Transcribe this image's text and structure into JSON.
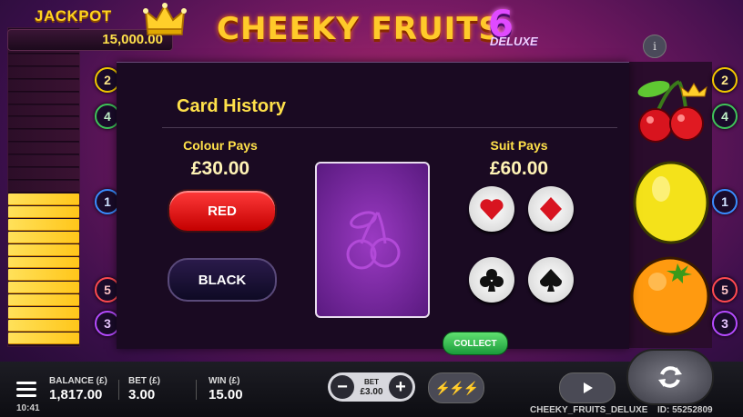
{
  "jackpot": {
    "label": "JACKPOT",
    "value": "15,000.00",
    "lit_rungs": 12,
    "total_rungs": 25
  },
  "title": {
    "main": "CHEEKY FRUITS",
    "number": "6",
    "subtitle": "DELUXE"
  },
  "info_label": "i",
  "left_badges": [
    "2",
    "4",
    "1",
    "5",
    "3"
  ],
  "right_badges": [
    "2",
    "4",
    "1",
    "5",
    "3"
  ],
  "card_history": {
    "heading": "Card History",
    "colour": {
      "label": "Colour Pays",
      "amount": "£30.00",
      "red_label": "RED",
      "black_label": "BLACK"
    },
    "suit": {
      "label": "Suit Pays",
      "amount": "£60.00",
      "suits": [
        "hearts-icon",
        "diamonds-icon",
        "clubs-icon",
        "spades-icon"
      ]
    },
    "collect_label": "COLLECT"
  },
  "bottom_bar": {
    "balance_label": "BALANCE (£)",
    "balance_value": "1,817.00",
    "bet_label": "BET (£)",
    "bet_value": "3.00",
    "win_label": "WIN (£)",
    "win_value": "15.00",
    "bet_control_label": "BET",
    "bet_control_value": "£3.00",
    "minus": "−",
    "plus": "+",
    "turbo_symbol": "⚡⚡⚡",
    "time": "10:41",
    "game_name": "CHEEKY_FRUITS_DELUXE",
    "id": "ID: 55252809"
  },
  "colors": {
    "accent_gold": "#ffca2a",
    "red": "#e01010",
    "green": "#2abf4a"
  }
}
